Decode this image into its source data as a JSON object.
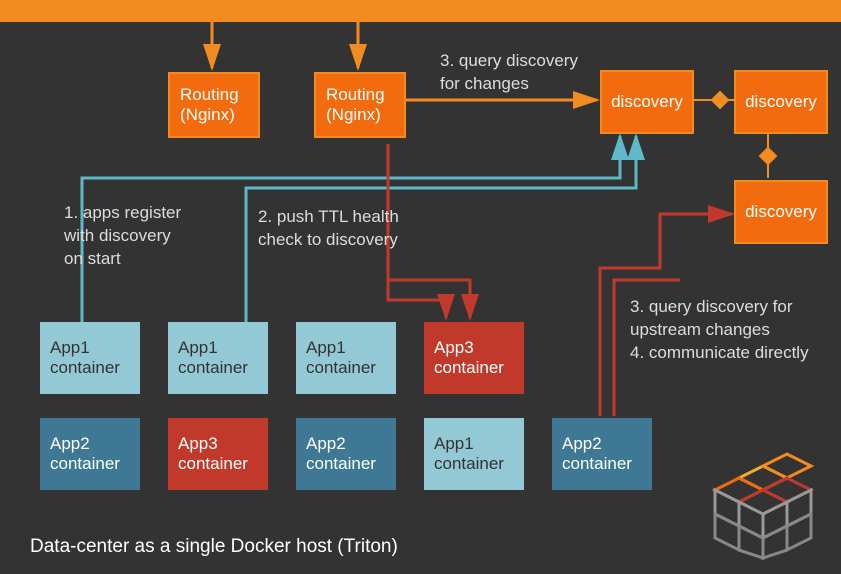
{
  "routing": {
    "box1": "Routing\n(Nginx)",
    "box2": "Routing\n(Nginx)"
  },
  "discovery": {
    "d1": "discovery",
    "d2": "discovery",
    "d3": "discovery"
  },
  "apps_row1": [
    {
      "label": "App1\ncontainer",
      "color": "light-teal"
    },
    {
      "label": "App1\ncontainer",
      "color": "light-teal"
    },
    {
      "label": "App1\ncontainer",
      "color": "light-teal"
    },
    {
      "label": "App3\ncontainer",
      "color": "red-box"
    }
  ],
  "apps_row2": [
    {
      "label": "App2\ncontainer",
      "color": "dark-teal"
    },
    {
      "label": "App3\ncontainer",
      "color": "red-box"
    },
    {
      "label": "App2\ncontainer",
      "color": "dark-teal"
    },
    {
      "label": "App1\ncontainer",
      "color": "light-teal"
    },
    {
      "label": "App2\ncontainer",
      "color": "dark-teal"
    }
  ],
  "annotations": {
    "step1": "1. apps register\nwith discovery\non start",
    "step2": "2. push TTL health\ncheck to discovery",
    "step3a": "3. query discovery\nfor changes",
    "step3b": "3. query discovery for\nupstream changes\n4. communicate directly"
  },
  "caption": "Data-center as a single Docker host (Triton)"
}
